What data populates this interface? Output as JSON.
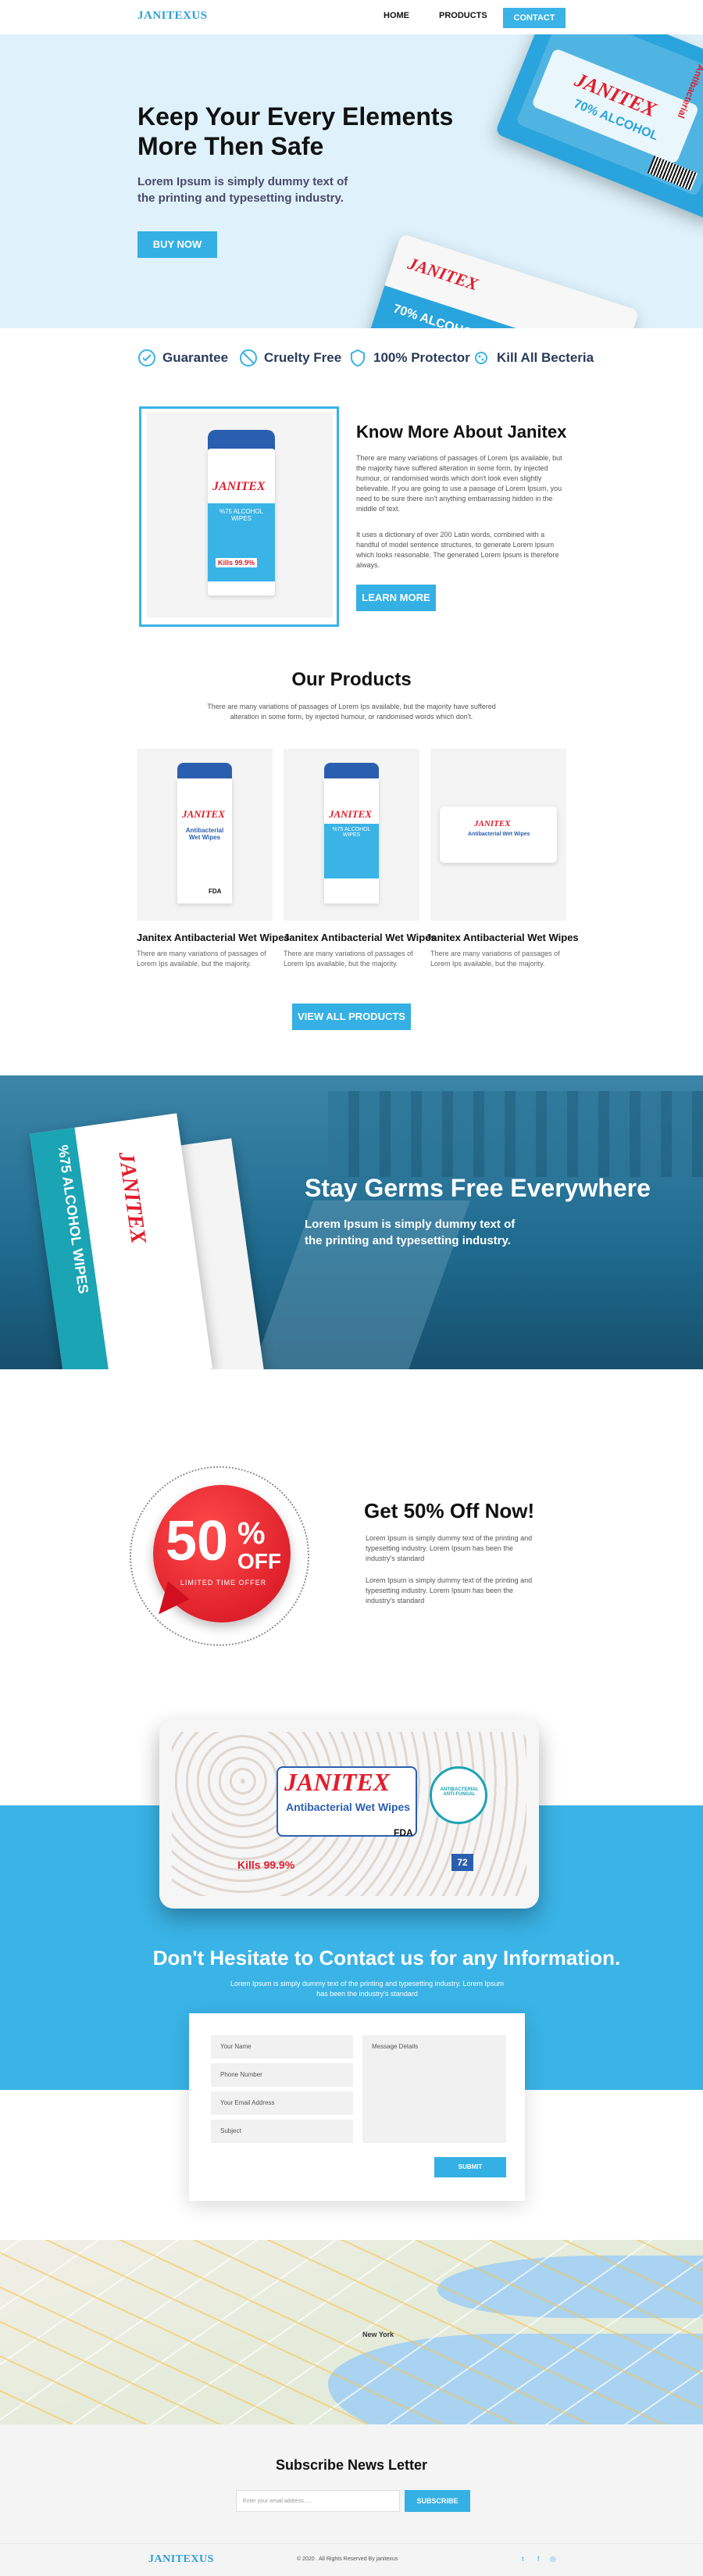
{
  "nav": {
    "logo": "JANITEXUS",
    "home": "HOME",
    "products": "PRODUCTS",
    "contact": "CONTACT"
  },
  "hero": {
    "title_line1": "Keep Your Every Elements",
    "title_line2": "More Then Safe",
    "subtitle_line1": "Lorem Ipsum is simply dummy text of",
    "subtitle_line2": "the printing and typesetting  industry.",
    "button": "BUY NOW",
    "pack_brand": "JANITEX",
    "pack_label": "70% ALCOHOL",
    "pack_side": "Antibacterial",
    "pack_wipes": "ALCOHOL WIPES"
  },
  "features": [
    {
      "label": "Guarantee",
      "icon": "guarantee-icon"
    },
    {
      "label": "Cruelty Free",
      "icon": "cruelty-free-icon"
    },
    {
      "label": "100% Protector",
      "icon": "protector-icon"
    },
    {
      "label": "Kill All Becteria",
      "icon": "bacteria-icon"
    }
  ],
  "about": {
    "title": "Know More About Janitex",
    "para1": "There are many variations of passages of Lorem Ips available, but the majority have suffered alteration in some form, by injected humour, or randomised words which don't look even slightly believable. If you are going to use a passage of Lorem Ipsum, you need to be sure there isn't anything embarrassing hidden in the middle of text.",
    "para2": "It uses a dictionary of over 200 Latin words, combined with a handful of model sentence structures, to generate Lorem Ipsum which looks reasonable. The generated Lorem Ipsum is therefore always.",
    "button": "LEARN MORE",
    "canister_brand": "JANITEX",
    "canister_label": "%75 ALCOHOL WIPES",
    "canister_kill": "Kills 99.9%"
  },
  "products": {
    "title": "Our Products",
    "subtitle": "There are many variations of passages of Lorem Ips available, but the majority have suffered alteration in some form, by injected humour, or randomised words which don't.",
    "items": [
      {
        "name": "Janitex Antibacterial Wet Wipes",
        "desc": "There are many variations of passages of Lorem Ips available, but the majority.",
        "label": "Antibacterial Wet Wipes"
      },
      {
        "name": "Janitex Antibacterial Wet Wipes",
        "desc": "There are many variations of passages of Lorem Ips available, but the majority.",
        "label": "%75 ALCOHOL WIPES"
      },
      {
        "name": "Janitex Antibacterial Wet Wipes",
        "desc": "There are many variations of passages of Lorem Ips available, but the majority.",
        "label": "Antibacterial Wet Wipes"
      }
    ],
    "brand": "JANITEX",
    "fda": "FDA",
    "button": "VIEW ALL PRODUCTS"
  },
  "germs": {
    "title": "Stay Germs Free Everywhere",
    "subtitle_line1": "Lorem Ipsum is simply dummy text of",
    "subtitle_line2": "the printing and typesetting  industry.",
    "sachet_label": "%75 ALCOHOL WIPES",
    "sachet_brand": "JANITEX"
  },
  "offer": {
    "badge_big": "50",
    "badge_pct": "%",
    "badge_off": "OFF",
    "badge_sub": "LIMITED TIME OFFER",
    "title": "Get 50% Off Now!",
    "para1": "Lorem Ipsum is simply dummy text of the printing and typesetting industry. Lorem Ipsum has been the industry's standard",
    "para2": "Lorem Ipsum is simply dummy text of the printing and typesetting industry. Lorem Ipsum has been the industry's standard"
  },
  "big_pack": {
    "brand": "JANITEX",
    "label": "Antibacterial Wet Wipes",
    "kills": "Kills 99.9%",
    "count": "72",
    "fda": "FDA",
    "seal": "ANTIBACTERIAL ANTI-FUNGAL"
  },
  "contact": {
    "title": "Don't Hesitate to Contact us for any Information.",
    "subtitle": "Lorem Ipsum is simply dummy text of the printing and typesetting industry. Lorem Ipsum has been the industry's standard",
    "name_placeholder": "Your Name",
    "phone_placeholder": "Phone Number",
    "email_placeholder": "Your Email Address",
    "subject_placeholder": "Subject",
    "message_placeholder": "Message Details",
    "button": "SUBMIT"
  },
  "map": {
    "label": "New York"
  },
  "subscribe": {
    "title": "Subscribe News Letter",
    "placeholder": "Enter your email address.....",
    "button": "SUBSCRIBE"
  },
  "footer": {
    "logo": "JANITEXUS",
    "copyright": "© 2020 . All Rights Reserved By janitexus",
    "twitter": "t",
    "facebook": "f",
    "instagram": "◎"
  },
  "colors": {
    "accent": "#3ab3e6",
    "hero_bg": "#dff2fb",
    "germs_bg": "#1f6f93",
    "brand_red": "#e21d2b"
  }
}
